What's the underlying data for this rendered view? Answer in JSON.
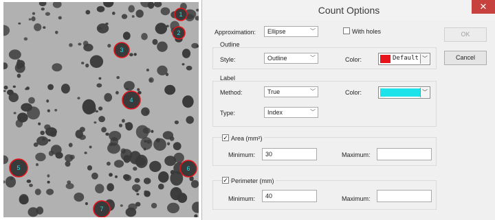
{
  "dialog": {
    "title": "Count Options",
    "close_glyph": "✕",
    "approximation_label": "Approximation:",
    "approximation_value": "Ellipse",
    "with_holes_label": "With holes",
    "with_holes_checked": false,
    "ok_label": "OK",
    "cancel_label": "Cancel",
    "outline": {
      "group_label": "Outline",
      "style_label": "Style:",
      "style_value": "Outline",
      "color_label": "Color:",
      "color_text": "Default",
      "color_swatch": "#e8141b"
    },
    "label": {
      "group_label": "Label",
      "method_label": "Method:",
      "method_value": "True",
      "color_label": "Color:",
      "color_swatch": "#1ee3ea",
      "type_label": "Type:",
      "type_value": "Index"
    },
    "area": {
      "checkbox_label": "Area (mm²)",
      "checked": true,
      "minimum_label": "Minimum:",
      "minimum_value": "30",
      "maximum_label": "Maximum:",
      "maximum_value": ""
    },
    "perimeter": {
      "checkbox_label": "Perimeter (mm)",
      "checked": true,
      "minimum_label": "Minimum:",
      "minimum_value": "40",
      "maximum_label": "Maximum:",
      "maximum_value": ""
    }
  },
  "micrograph": {
    "marked_labels": [
      "1",
      "2",
      "3",
      "4",
      "5",
      "6",
      "7"
    ],
    "background_color": "#b1b1b1",
    "particle_color": "#3a3a3a",
    "outline_color": "#e8141b",
    "label_color": "#1ee3ea"
  }
}
